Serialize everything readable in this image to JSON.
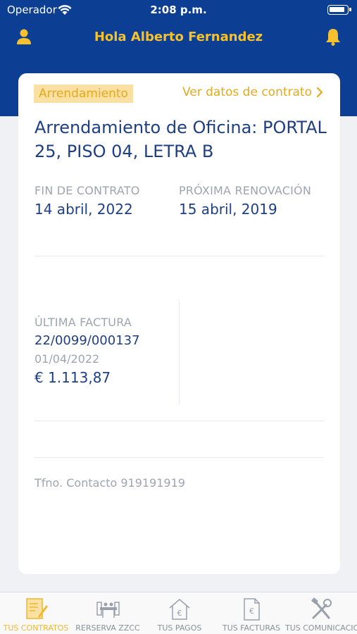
{
  "status_bar": {
    "carrier": "Operador",
    "time": "2:08 p.m."
  },
  "header": {
    "title": "Hola Alberto Fernandez"
  },
  "contract": {
    "type_badge": "Arrendamiento",
    "view_link": "Ver datos de contrato",
    "title": "Arrendamiento de Oficina: PORTAL 25, PISO 04, LETRA B",
    "end_label": "FIN DE CONTRATO",
    "end_date": "14 abril, 2022",
    "renewal_label": "PRÓXIMA RENOVACIÓN",
    "renewal_date": "15 abril, 2019"
  },
  "last_invoice": {
    "label": "ÚLTIMA FACTURA",
    "number": "22/0099/000137",
    "date": "01/04/2022",
    "amount": "€ 1.113,87"
  },
  "contact": {
    "phone": "Tfno. Contacto 919191919"
  },
  "tabs": [
    {
      "label": "TUS CONTRATOS",
      "icon": "contract-pen-icon",
      "active": true
    },
    {
      "label": "RERSERVA ZZCC",
      "icon": "meeting-room-icon",
      "active": false
    },
    {
      "label": "TUS PAGOS",
      "icon": "house-euro-icon",
      "active": false
    },
    {
      "label": "TUS FACTURAS",
      "icon": "invoice-euro-icon",
      "active": false
    },
    {
      "label": "TUS COMUNICACIONES",
      "icon": "tools-icon",
      "active": false
    }
  ],
  "colors": {
    "header": "#0c3f94",
    "accent": "#f5c12e",
    "text_primary": "#1e3f86",
    "text_muted": "#9ea4b0"
  }
}
